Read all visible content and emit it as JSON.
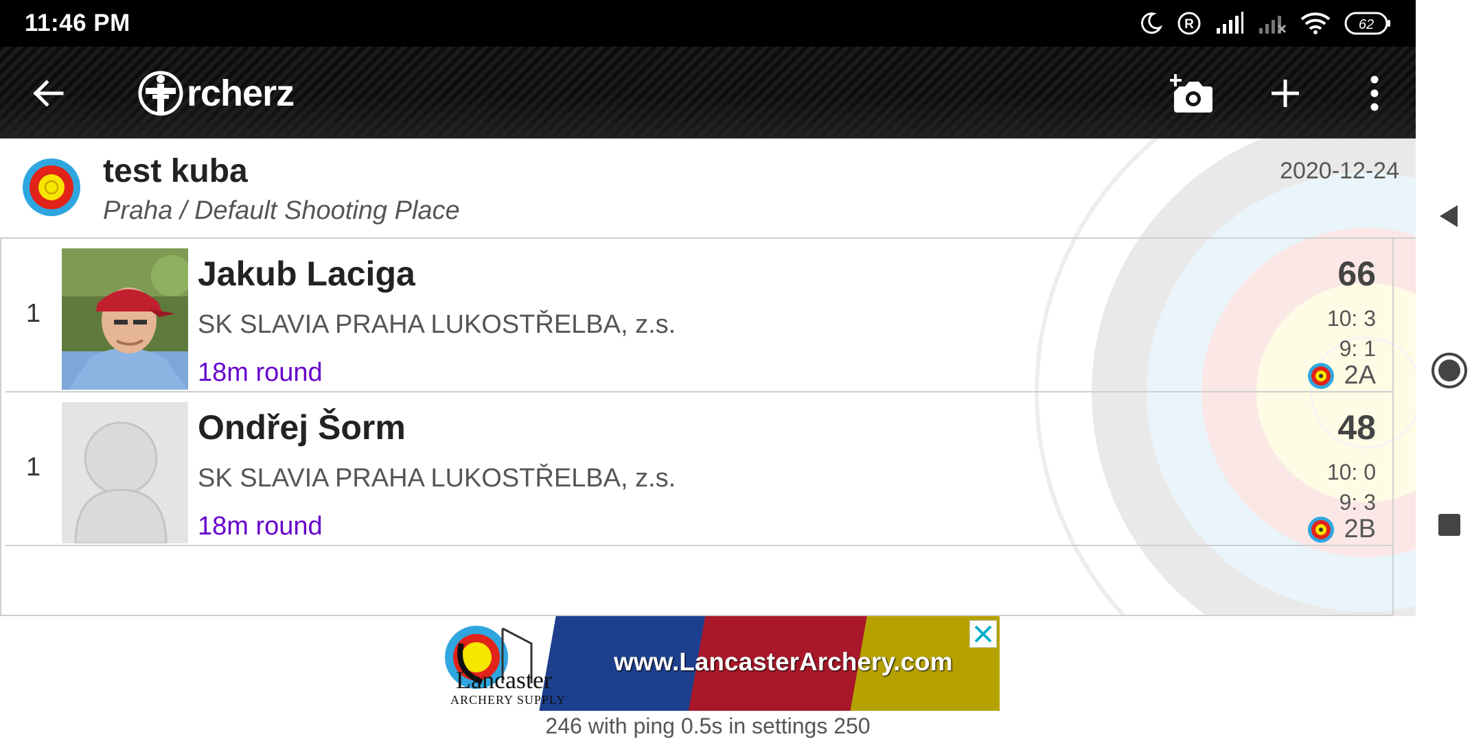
{
  "status_bar": {
    "time": "11:46 PM",
    "battery": "62",
    "icons": [
      "moon-icon",
      "registered-icon",
      "signal-icon",
      "signal-no-sim-icon",
      "wifi-icon",
      "battery-icon"
    ]
  },
  "toolbar": {
    "back_icon": "arrow-left-icon",
    "logo_text": "rcherz",
    "camera_icon": "add-photo-icon",
    "add_icon": "plus-icon",
    "menu_icon": "more-vert-icon"
  },
  "event": {
    "title": "test kuba",
    "place": "Praha / Default Shooting Place",
    "date": "2020-12-24"
  },
  "results": [
    {
      "rank": "1",
      "name": "Jakub Laciga",
      "club": "SK SLAVIA PRAHA LUKOSTŘELBA, z.s.",
      "round": "18m round",
      "score": "66",
      "tens": "10: 3",
      "nines": "9: 1",
      "target": "2A",
      "photo": "athlete-photo"
    },
    {
      "rank": "1",
      "name": "Ondřej Šorm",
      "club": "SK SLAVIA PRAHA LUKOSTŘELBA, z.s.",
      "round": "18m round",
      "score": "48",
      "tens": "10: 0",
      "nines": "9: 3",
      "target": "2B",
      "photo": "placeholder-avatar"
    }
  ],
  "ad": {
    "brand": "Lancaster",
    "sub": "ARCHERY SUPPLY",
    "url": "www.LancasterArchery.com",
    "close_icon": "close-icon"
  },
  "footer": {
    "text": "246 with ping 0.5s in settings 250"
  },
  "colors": {
    "round_link": "#6600cc",
    "target_yellow": "#f7e600",
    "target_red": "#e2231a",
    "target_blue": "#2fa6e0"
  }
}
